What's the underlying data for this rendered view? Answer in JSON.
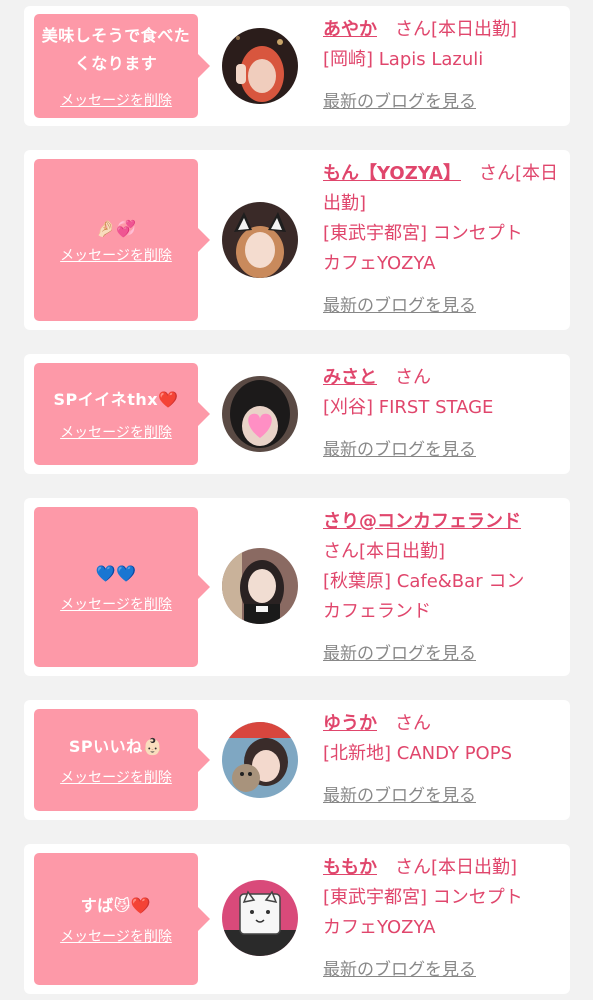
{
  "colors": {
    "background": "#f2f2f2",
    "bubble": "#fd99a8",
    "accent_text": "#e0466c",
    "link_gray": "#888888"
  },
  "messages": [
    {
      "message": "美味しそうで食べたくなります",
      "delete_label": "メッセージを削除",
      "name": "あやか",
      "suffix": "さん[本日出勤]",
      "shop_line1": "[岡崎] Lapis Lazuli",
      "shop_line2": "",
      "blog_label": "最新のブログを見る"
    },
    {
      "message": "🤌🏻💞",
      "delete_label": "メッセージを削除",
      "name": "もん【YOZYA】",
      "suffix": "さん[本日出勤]",
      "shop_line1": "[東武宇都宮] コンセプト",
      "shop_line2": "カフェYOZYA",
      "blog_label": "最新のブログを見る"
    },
    {
      "message": "SPイイネthx❤️",
      "delete_label": "メッセージを削除",
      "name": "みさと",
      "suffix": "さん",
      "shop_line1": "[刈谷] FIRST STAGE",
      "shop_line2": "",
      "blog_label": "最新のブログを見る"
    },
    {
      "message": "💙💙",
      "delete_label": "メッセージを削除",
      "name": "さり@コンカフェランド",
      "suffix": "さん[本日出勤]",
      "shop_line1": "[秋葉原] Cafe&Bar コン",
      "shop_line2": "カフェランド",
      "blog_label": "最新のブログを見る"
    },
    {
      "message": "SPいいね👶🏻",
      "delete_label": "メッセージを削除",
      "name": "ゆうか",
      "suffix": "さん",
      "shop_line1": "[北新地] CANDY POPS",
      "shop_line2": "",
      "blog_label": "最新のブログを見る"
    },
    {
      "message": "すば😼❤️",
      "delete_label": "メッセージを削除",
      "name": "ももか",
      "suffix": "さん[本日出勤]",
      "shop_line1": "[東武宇都宮] コンセプト",
      "shop_line2": "カフェYOZYA",
      "blog_label": "最新のブログを見る"
    }
  ]
}
